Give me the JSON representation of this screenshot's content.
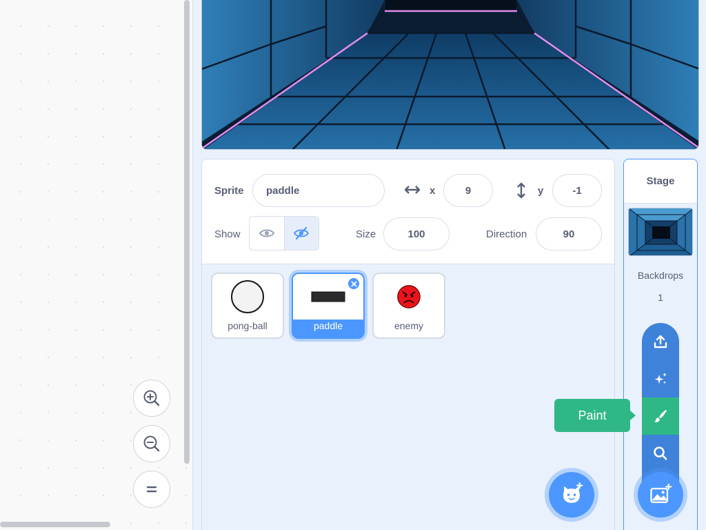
{
  "colors": {
    "accent": "#4c97ff",
    "paint_green": "#2fb886",
    "menu_blue": "#3f82d9",
    "text": "#575e75"
  },
  "code_area": {
    "zoom_in_icon": "zoom-in-icon",
    "zoom_out_icon": "zoom-out-icon",
    "zoom_reset_icon": "equals-icon"
  },
  "sprite_info": {
    "sprite_label": "Sprite",
    "sprite_name": "paddle",
    "x_label": "x",
    "x_value": "9",
    "y_label": "y",
    "y_value": "-1",
    "show_label": "Show",
    "visible": true,
    "size_label": "Size",
    "size_value": "100",
    "direction_label": "Direction",
    "direction_value": "90"
  },
  "sprites": [
    {
      "name": "pong-ball",
      "selected": false,
      "icon": "ball-thumbnail"
    },
    {
      "name": "paddle",
      "selected": true,
      "icon": "paddle-thumbnail"
    },
    {
      "name": "enemy",
      "selected": false,
      "icon": "angry-face-thumbnail"
    }
  ],
  "stage": {
    "header": "Stage",
    "backdrops_label": "Backdrops",
    "backdrops_count": "1"
  },
  "backdrop_menu": {
    "items": [
      "upload-icon",
      "surprise-icon",
      "paint-icon",
      "search-icon"
    ],
    "active": "paint-icon",
    "tooltip": "Paint"
  }
}
